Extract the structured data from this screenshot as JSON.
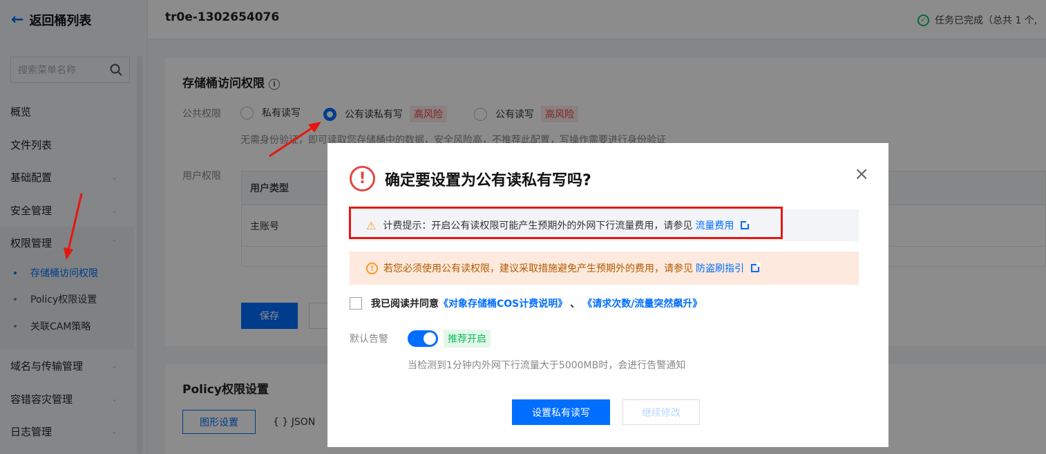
{
  "sidebar": {
    "back_label": "返回桶列表",
    "search_placeholder": "搜索菜单名称",
    "items": [
      {
        "label": "概览",
        "chevron": false
      },
      {
        "label": "文件列表",
        "chevron": false
      },
      {
        "label": "基础配置",
        "chevron": true
      },
      {
        "label": "安全管理",
        "chevron": true
      }
    ],
    "group": {
      "label": "权限管理",
      "subs": [
        {
          "label": "存储桶访问权限",
          "active": true
        },
        {
          "label": "Policy权限设置",
          "active": false
        },
        {
          "label": "关联CAM策略",
          "active": false
        }
      ]
    },
    "items_after": [
      {
        "label": "域名与传输管理"
      },
      {
        "label": "容错容灾管理"
      },
      {
        "label": "日志管理"
      }
    ]
  },
  "header": {
    "bucket_name": "tr0e-1302654076",
    "task_status": "任务已完成（总共 1 个,"
  },
  "bucket_acl": {
    "title": "存储桶访问权限",
    "public_label": "公共权限",
    "options": [
      {
        "label": "私有读写",
        "checked": false,
        "risk": ""
      },
      {
        "label": "公有读私有写",
        "checked": true,
        "risk": "高风险"
      },
      {
        "label": "公有读写",
        "checked": false,
        "risk": "高风险"
      }
    ],
    "description": "无需身份验证，即可读取您存储桶中的数据，安全风险高，不推荐此配置，写操作需要进行身份验证",
    "user_label": "用户权限",
    "table_header": "用户类型",
    "table_rows": [
      "主账号",
      ""
    ],
    "save_label": "保存"
  },
  "policy": {
    "title": "Policy权限设置",
    "tabs": [
      "图形设置",
      "{ } JSON"
    ]
  },
  "modal": {
    "title": "确定要设置为公有读私有写吗?",
    "close": "×",
    "billing_notice": "计费提示：开启公有读权限可能产生预期外的外网下行流量费用，请参见",
    "billing_link": "流量费用",
    "security_notice": "若您必须使用公有读权限，建议采取措施避免产生预期外的费用，请参见",
    "security_link": "防盗刷指引",
    "agree_text": "我已阅读并同意",
    "agree_link1": "《对象存储桶COS计费说明》",
    "agree_sep": "、",
    "agree_link2": "《请求次数/流量突然飙升》",
    "alarm_label": "默认告警",
    "alarm_on": true,
    "alarm_tag": "推荐开启",
    "alarm_hint": "当检测到1分钟内外网下行流量大于5000MB时，会进行告警通知",
    "primary_button": "设置私有读写",
    "secondary_button": "继续修改"
  },
  "colors": {
    "brand": "#006eff",
    "danger": "#e54545",
    "annotation": "#e5170f",
    "success": "#0abf5b",
    "warning": "#f59a23"
  }
}
